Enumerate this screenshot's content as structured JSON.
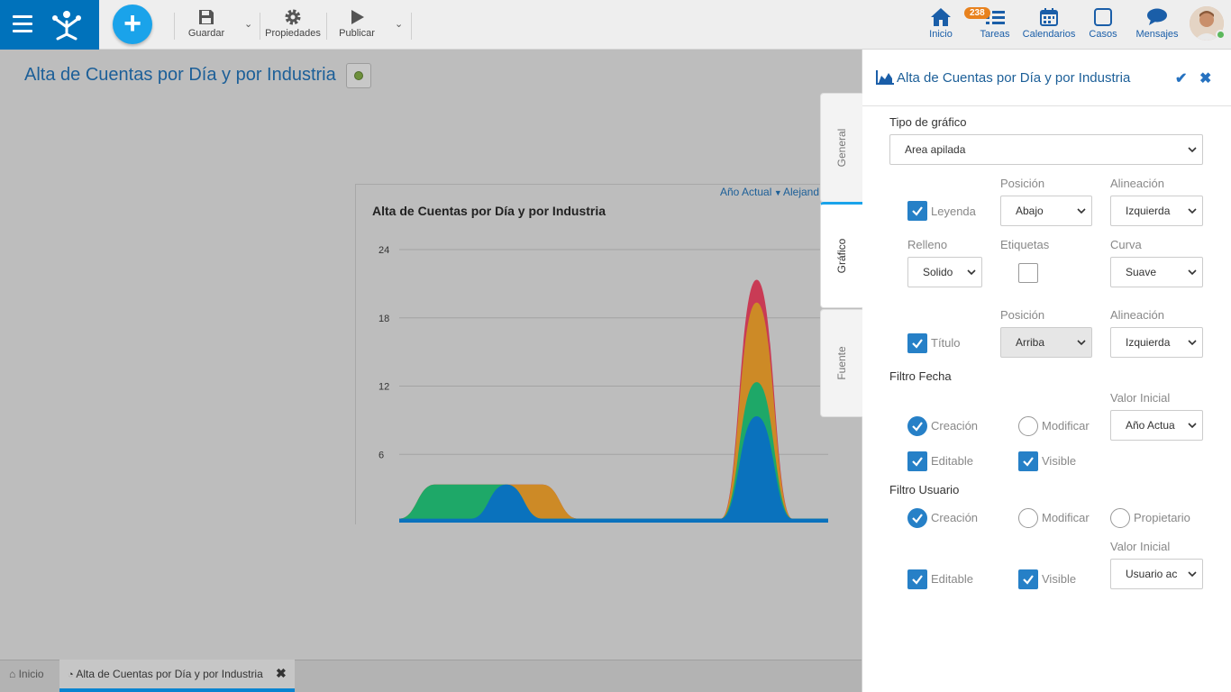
{
  "topbar": {
    "guardar": "Guardar",
    "propiedades": "Propiedades",
    "publicar": "Publicar",
    "nav": [
      {
        "label": "Inicio",
        "icon": "home-icon"
      },
      {
        "label": "Tareas",
        "icon": "tasks-icon"
      },
      {
        "label": "Calendarios",
        "icon": "calendar-icon"
      },
      {
        "label": "Casos",
        "icon": "cases-icon"
      },
      {
        "label": "Mensajes",
        "icon": "messages-icon"
      }
    ],
    "tasks_badge": "238"
  },
  "page": {
    "title": "Alta de Cuentas por Día y por Industria"
  },
  "chart": {
    "filter_date": "Año Actual",
    "filter_user": "Alejand",
    "title": "Alta de Cuentas por Día y por Industria"
  },
  "chart_data": {
    "type": "area",
    "stacked": true,
    "title": "Alta de Cuentas por Día y por Industria",
    "xlabel": "",
    "ylabel": "",
    "ylim": [
      0,
      24
    ],
    "yticks": [
      6,
      12,
      18,
      24
    ],
    "grid": true,
    "x": [
      0,
      1,
      2,
      3,
      4,
      5,
      6,
      7,
      8,
      9,
      10,
      11,
      12
    ],
    "series": [
      {
        "color": "#0a72bd",
        "values": [
          0,
          0,
          0,
          3,
          0,
          0,
          0,
          0,
          0,
          0,
          9,
          0,
          0
        ]
      },
      {
        "color": "#1ea868",
        "values": [
          0,
          3,
          3,
          0,
          0,
          0,
          0,
          0,
          0,
          0,
          3,
          0,
          0
        ]
      },
      {
        "color": "#cd8a26",
        "values": [
          0,
          0,
          0,
          0,
          3,
          0,
          0,
          0,
          0,
          0,
          7,
          0,
          0
        ]
      },
      {
        "color": "#c93b55",
        "values": [
          0,
          0,
          0,
          0,
          0,
          0,
          0,
          0,
          0,
          0,
          2,
          0,
          0
        ]
      }
    ]
  },
  "bottom_tabs": {
    "home": "Inicio",
    "active": "Alta de Cuentas por Día y por Industria"
  },
  "panel": {
    "title": "Alta de Cuentas por Día y por Industria",
    "tabs": [
      "General",
      "Gráfico",
      "Fuente"
    ],
    "tipo_label": "Tipo de gráfico",
    "tipo_value": "Area apilada",
    "posicion_label": "Posición",
    "alineacion_label": "Alineación",
    "leyenda_label": "Leyenda",
    "leyenda_pos": "Abajo",
    "leyenda_align": "Izquierda",
    "relleno_label": "Relleno",
    "etiquetas_label": "Etiquetas",
    "curva_label": "Curva",
    "relleno_value": "Solido",
    "curva_value": "Suave",
    "posicion2_label": "Posición",
    "alineacion2_label": "Alineación",
    "titulo_label": "Título",
    "titulo_pos": "Arriba",
    "titulo_align": "Izquierda",
    "filtro_fecha_label": "Filtro Fecha",
    "valor_inicial_label": "Valor Inicial",
    "creacion_label": "Creación",
    "modificar_label": "Modificar",
    "fecha_valor": "Año Actua",
    "editable_label": "Editable",
    "visible_label": "Visible",
    "filtro_usuario_label": "Filtro Usuario",
    "creacion2_label": "Creación",
    "modificar2_label": "Modificar",
    "propietario_label": "Propietario",
    "valor_inicial2_label": "Valor Inicial",
    "editable2_label": "Editable",
    "visible2_label": "Visible",
    "usuario_valor": "Usuario ac"
  }
}
